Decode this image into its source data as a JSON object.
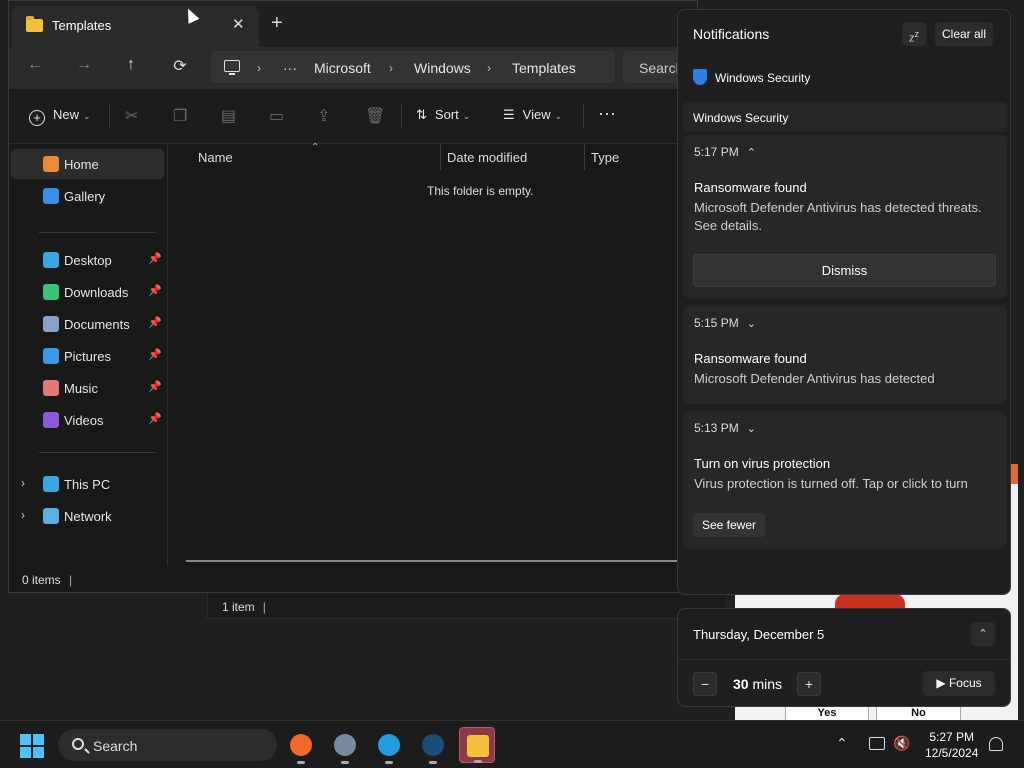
{
  "explorer": {
    "tab_title": "Templates",
    "tab_close": "✕",
    "new_tab": "+",
    "nav": {
      "back": "←",
      "forward": "→",
      "up": "↑",
      "refresh": "⟳"
    },
    "breadcrumb": {
      "more": "···",
      "items": [
        "Microsoft",
        "Windows",
        "Templates"
      ]
    },
    "search_placeholder": "Search",
    "toolbar": {
      "new_label": "New",
      "sort_label": "Sort",
      "view_label": "View",
      "more": "···"
    },
    "sidebar": [
      {
        "label": "Home",
        "icon": "home-icon",
        "color": "#e98b3b",
        "selected": true
      },
      {
        "label": "Gallery",
        "icon": "gallery-icon",
        "color": "#3a8ee6"
      },
      {
        "label": "Desktop",
        "icon": "desktop-icon",
        "color": "#3ca6e0",
        "pinned": true
      },
      {
        "label": "Downloads",
        "icon": "downloads-icon",
        "color": "#3cc07a",
        "pinned": true
      },
      {
        "label": "Documents",
        "icon": "documents-icon",
        "color": "#8aa0c8",
        "pinned": true
      },
      {
        "label": "Pictures",
        "icon": "pictures-icon",
        "color": "#3a9ae8",
        "pinned": true
      },
      {
        "label": "Music",
        "icon": "music-icon",
        "color": "#e07a7a",
        "pinned": true
      },
      {
        "label": "Videos",
        "icon": "videos-icon",
        "color": "#8a5ad8",
        "pinned": true
      },
      {
        "label": "This PC",
        "icon": "this-pc-icon",
        "color": "#3ca6e0",
        "expandable": true
      },
      {
        "label": "Network",
        "icon": "network-icon",
        "color": "#5ab0e0",
        "expandable": true
      }
    ],
    "columns": [
      "Name",
      "Date modified",
      "Type"
    ],
    "empty_message": "This folder is empty.",
    "status": "0 items"
  },
  "background_window": {
    "status": "1 item"
  },
  "popup": {
    "yes_label": "Yes",
    "no_label": "No"
  },
  "notifications": {
    "title": "Notifications",
    "clear_all": "Clear all",
    "app_name": "Windows Security",
    "group_name": "Windows Security",
    "items": [
      {
        "time": "5:17 PM",
        "chevron": "⌃",
        "title": "Ransomware found",
        "body": "Microsoft Defender Antivirus has detected threats. See details.",
        "action": "Dismiss"
      },
      {
        "time": "5:15 PM",
        "chevron": "⌄",
        "title": "Ransomware found",
        "body": "Microsoft Defender Antivirus has detected"
      },
      {
        "time": "5:13 PM",
        "chevron": "⌄",
        "title": "Turn on virus protection",
        "body": "Virus protection is turned off. Tap or click to turn"
      }
    ],
    "see_fewer": "See fewer"
  },
  "calendar": {
    "date": "Thursday, December 5",
    "focus_value": "30",
    "focus_unit": "mins",
    "focus_label": "Focus",
    "minus": "−",
    "plus": "+"
  },
  "taskbar": {
    "search_label": "Search",
    "apps": [
      {
        "name": "firefox-icon",
        "color": "#f2682a"
      },
      {
        "name": "settings-icon",
        "color": "#7a8aa0"
      },
      {
        "name": "edge-icon",
        "color": "#1f9ee0"
      },
      {
        "name": "steam-icon",
        "color": "#1b4d7a"
      },
      {
        "name": "file-explorer-icon",
        "color": "#f3c13c"
      }
    ],
    "time": "5:27 PM",
    "date": "12/5/2024"
  }
}
